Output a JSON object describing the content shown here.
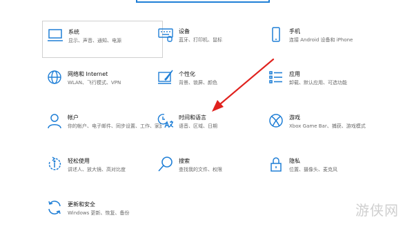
{
  "settings": {
    "tiles": [
      {
        "title": "系统",
        "subtitle": "显示、声音、通知、电源",
        "icon": "monitor-icon"
      },
      {
        "title": "设备",
        "subtitle": "蓝牙、打印机、鼠标",
        "icon": "keyboard-icon"
      },
      {
        "title": "手机",
        "subtitle": "连接 Android 设备和 iPhone",
        "icon": "phone-icon"
      },
      {
        "title": "网络和 Internet",
        "subtitle": "WLAN、飞行模式、VPN",
        "icon": "globe-icon"
      },
      {
        "title": "个性化",
        "subtitle": "背景、锁屏、颜色",
        "icon": "paintbrush-icon"
      },
      {
        "title": "应用",
        "subtitle": "卸载、默认应用、可选功能",
        "icon": "apps-list-icon"
      },
      {
        "title": "帐户",
        "subtitle": "你的帐户、电子邮件、同步设置、工作、家庭",
        "icon": "person-icon"
      },
      {
        "title": "时间和语言",
        "subtitle": "语音、区域、日期",
        "icon": "time-language-icon"
      },
      {
        "title": "游戏",
        "subtitle": "Xbox Game Bar、捕获、游戏模式",
        "icon": "xbox-icon"
      },
      {
        "title": "轻松使用",
        "subtitle": "讲述人、放大镜、高对比度",
        "icon": "ease-of-access-icon"
      },
      {
        "title": "搜索",
        "subtitle": "查找我的文件、权限",
        "icon": "search-icon"
      },
      {
        "title": "隐私",
        "subtitle": "位置、摄像头、麦克风",
        "icon": "lock-icon"
      },
      {
        "title": "更新和安全",
        "subtitle": "Windows 更新、恢复、备份",
        "icon": "update-icon"
      }
    ]
  },
  "annotation": {
    "arrow_color": "#e0221e"
  },
  "watermark": {
    "text": "游侠网"
  },
  "colors": {
    "accent": "#1e7ed6"
  }
}
